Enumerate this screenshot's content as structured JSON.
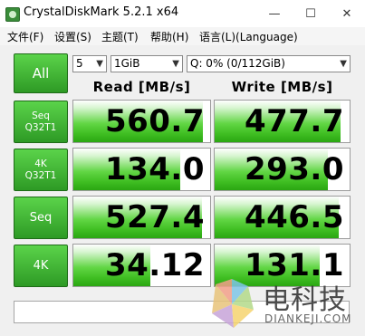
{
  "window": {
    "title": "CrystalDiskMark 5.2.1 x64",
    "minimize": "—",
    "maximize": "☐",
    "close": "✕"
  },
  "menu": [
    "文件(F)",
    "设置(S)",
    "主题(T)",
    "帮助(H)",
    "语言(L)(Language)"
  ],
  "controls": {
    "all_label": "All",
    "count": "5",
    "size": "1GiB",
    "drive": "Q: 0% (0/112GiB)"
  },
  "headers": {
    "read": "Read [MB/s]",
    "write": "Write [MB/s]"
  },
  "rows": [
    {
      "label1": "Seq",
      "label2": "Q32T1",
      "read": "560.7",
      "write": "477.7",
      "read_level": 0.95,
      "write_level": 0.93
    },
    {
      "label1": "4K",
      "label2": "Q32T1",
      "read": "134.0",
      "write": "293.0",
      "read_level": 0.78,
      "write_level": 0.84
    },
    {
      "label1": "Seq",
      "label2": "",
      "read": "527.4",
      "write": "446.5",
      "read_level": 0.94,
      "write_level": 0.92
    },
    {
      "label1": "4K",
      "label2": "",
      "read": "34.12",
      "write": "131.1",
      "read_level": 0.56,
      "write_level": 0.78
    }
  ],
  "watermark": {
    "text": "电科技",
    "sub": "DIANKEJI.COM"
  },
  "colors": {
    "accent_green": "#3fbe22",
    "button_green": "#2e9a25"
  }
}
